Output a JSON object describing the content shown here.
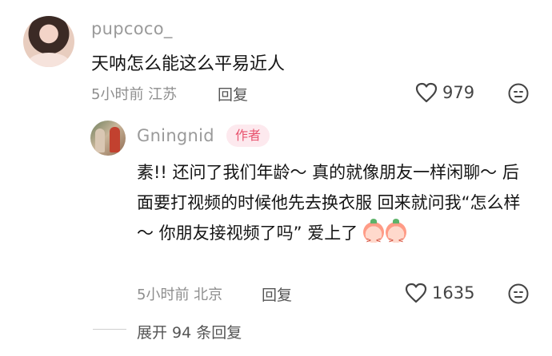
{
  "comment": {
    "username": "pupcoco_",
    "text": "天呐怎么能这么平易近人",
    "meta": "5小时前 江苏",
    "reply_label": "回复",
    "likes": "979"
  },
  "reply": {
    "username": "Gningnid",
    "badge": "作者",
    "text": "素!!  还问了我们年龄～ 真的就像朋友一样闲聊～ 后面要打视频的时候他先去换衣服 回来就问我“怎么样～ 你朋友接视频了吗” 爱上了",
    "meta": "5小时前 北京",
    "reply_label": "回复",
    "likes": "1635"
  },
  "expand_label": "展开 94 条回复",
  "icons": {
    "like": "heart-outline-icon",
    "dislike": "unhappy-face-icon",
    "emoji": "peach-laugh-emoji-icon"
  }
}
